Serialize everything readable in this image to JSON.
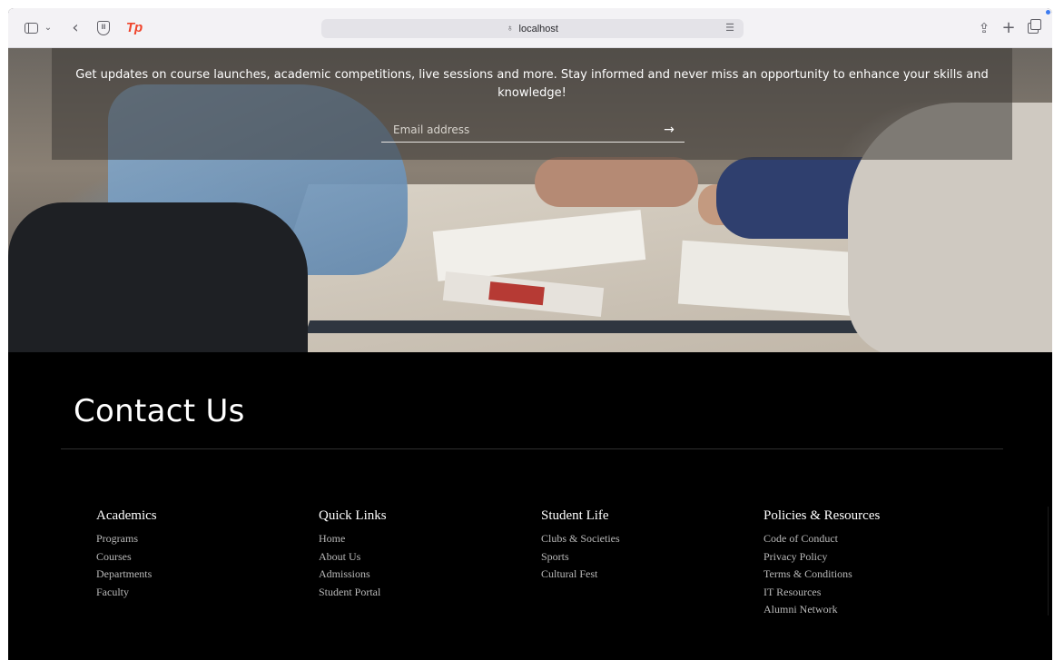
{
  "browser": {
    "address": "localhost"
  },
  "newsletter": {
    "text": "Get updates on course launches, academic competitions, live sessions and more. Stay informed and never miss an opportunity to enhance your skills and knowledge!",
    "email_placeholder": "Email address",
    "submit_glyph": "→"
  },
  "footer": {
    "title": "Contact Us",
    "columns": [
      {
        "heading": "Academics",
        "links": [
          "Programs",
          "Courses",
          "Departments",
          "Faculty"
        ]
      },
      {
        "heading": "Quick Links",
        "links": [
          "Home",
          "About Us",
          "Admissions",
          "Student Portal"
        ]
      },
      {
        "heading": "Student Life",
        "links": [
          "Clubs & Societies",
          "Sports",
          "Cultural Fest"
        ]
      },
      {
        "heading": "Policies & Resources",
        "links": [
          "Code of Conduct",
          "Privacy Policy",
          "Terms & Conditions",
          "IT Resources",
          "Alumni Network"
        ]
      }
    ]
  },
  "icons": {
    "sidebar": "sidebar-icon",
    "back": "chevron-left-icon",
    "privacy": "shield-icon",
    "extension": "tp-logo-icon",
    "share": "share-icon",
    "new_tab": "plus-icon",
    "tabs": "tabs-overview-icon",
    "submit": "arrow-right-icon"
  },
  "colors": {
    "toolbar": "#f3f2f5",
    "footer_bg": "#000000",
    "footer_link": "#b9b9b9",
    "extension_logo": "#f0442b"
  }
}
